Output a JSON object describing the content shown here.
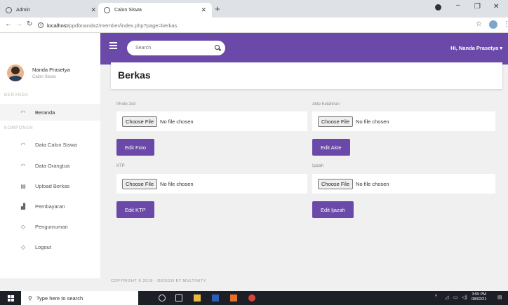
{
  "browser": {
    "tabs": [
      {
        "title": "Admin",
        "active": false
      },
      {
        "title": "Calon Siswa",
        "active": true
      }
    ],
    "url_host": "localhost",
    "url_path": "/ppdbnanda2/member/index.php?page=berkas"
  },
  "sidebar": {
    "user_name": "Nanda Prasetya",
    "user_role": "Calon Siswa",
    "section_home": "BERANDA",
    "section_components": "KOMPONEN",
    "items": [
      {
        "label": "Beranda",
        "icon": "dashboard-icon"
      },
      {
        "label": "Data Calon Siswa",
        "icon": "dashboard-icon"
      },
      {
        "label": "Data Orangtua",
        "icon": "dashboard-icon"
      },
      {
        "label": "Upload Berkas",
        "icon": "file-icon"
      },
      {
        "label": "Pembayaran",
        "icon": "bar-chart-icon"
      },
      {
        "label": "Pengumuman",
        "icon": "shield-icon"
      },
      {
        "label": "Logout",
        "icon": "shield-icon"
      }
    ]
  },
  "header": {
    "search_placeholder": "Search",
    "greeting": "Hi, Nanda Prasetya ▾"
  },
  "page": {
    "title": "Berkas",
    "uploads": [
      {
        "label": "Photo 2x3",
        "choose": "Choose File",
        "status": "No file chosen",
        "button": "Edit Foto"
      },
      {
        "label": "Akte Kelahiran",
        "choose": "Choose File",
        "status": "No file chosen",
        "button": "Edit Akte"
      },
      {
        "label": "KTP",
        "choose": "Choose File",
        "status": "No file chosen",
        "button": "Edit KTP"
      },
      {
        "label": "Ijazah",
        "choose": "Choose File",
        "status": "No file chosen",
        "button": "Edit Ijazah"
      }
    ]
  },
  "footer": {
    "text": "COPYRIGHT © 2018 - DESIGN BY MULTINITY"
  },
  "taskbar": {
    "search_text": "Type here to search",
    "time": "3:55 PM",
    "date": "08/02/21"
  },
  "colors": {
    "accent": "#6b49a8"
  }
}
